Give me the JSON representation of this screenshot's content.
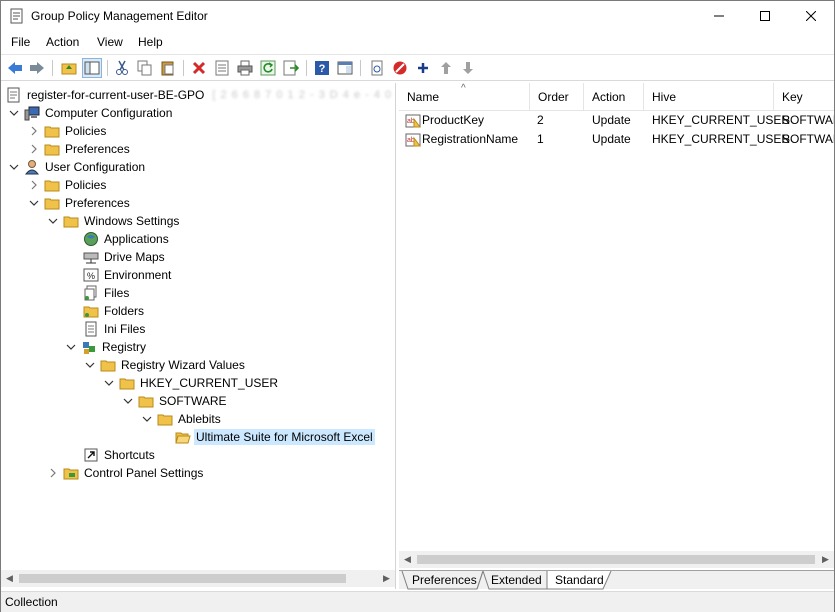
{
  "window": {
    "title": "Group Policy Management Editor",
    "minimize_glyph": "—",
    "maximize_glyph": "☐",
    "close_glyph": "✕"
  },
  "menu": [
    "File",
    "Action",
    "View",
    "Help"
  ],
  "toolbar": {
    "icons": [
      "back-arrow-icon",
      "forward-arrow-icon",
      "up-folder-icon",
      "show-hide-tree-icon",
      "cut-icon",
      "copy-icon",
      "paste-icon",
      "delete-icon",
      "properties-icon",
      "print-icon",
      "refresh-icon",
      "export-list-icon",
      "help-icon",
      "show-action-pane-icon",
      "new-document-icon",
      "stop-icon",
      "add-icon",
      "move-up-icon",
      "move-down-icon"
    ]
  },
  "tree": {
    "root": {
      "label": "register-for-current-user-BE-GPO",
      "suffix_blurred": "[ 2 6 6 8 7 0 1 2 - 3 D 4 e - 4 0 8 1 - 6 7 8 7 ]"
    },
    "items": [
      {
        "label": "Computer Configuration"
      },
      {
        "label": "Policies"
      },
      {
        "label": "Preferences"
      },
      {
        "label": "User Configuration"
      },
      {
        "label": "Policies"
      },
      {
        "label": "Preferences"
      },
      {
        "label": "Windows Settings"
      },
      {
        "label": "Applications"
      },
      {
        "label": "Drive Maps"
      },
      {
        "label": "Environment"
      },
      {
        "label": "Files"
      },
      {
        "label": "Folders"
      },
      {
        "label": "Ini Files"
      },
      {
        "label": "Registry"
      },
      {
        "label": "Registry Wizard Values"
      },
      {
        "label": "HKEY_CURRENT_USER"
      },
      {
        "label": "SOFTWARE"
      },
      {
        "label": "Ablebits"
      },
      {
        "label": "Ultimate Suite for Microsoft Excel"
      },
      {
        "label": "Shortcuts"
      },
      {
        "label": "Control Panel Settings"
      }
    ]
  },
  "list": {
    "columns": [
      "Name",
      "Order",
      "Action",
      "Hive",
      "Key"
    ],
    "rows": [
      {
        "name": "ProductKey",
        "order": "2",
        "action": "Update",
        "hive": "HKEY_CURRENT_USER",
        "key": "SOFTWARE"
      },
      {
        "name": "RegistrationName",
        "order": "1",
        "action": "Update",
        "hive": "HKEY_CURRENT_USER",
        "key": "SOFTWARE"
      }
    ]
  },
  "tabs": [
    "Preferences",
    "Extended",
    "Standard"
  ],
  "active_tab": "Standard",
  "status": {
    "text": "Collection"
  },
  "colors": {
    "selection": "#cce8ff",
    "folder": "#f0c24a",
    "accent_blue": "#1c60c8"
  }
}
